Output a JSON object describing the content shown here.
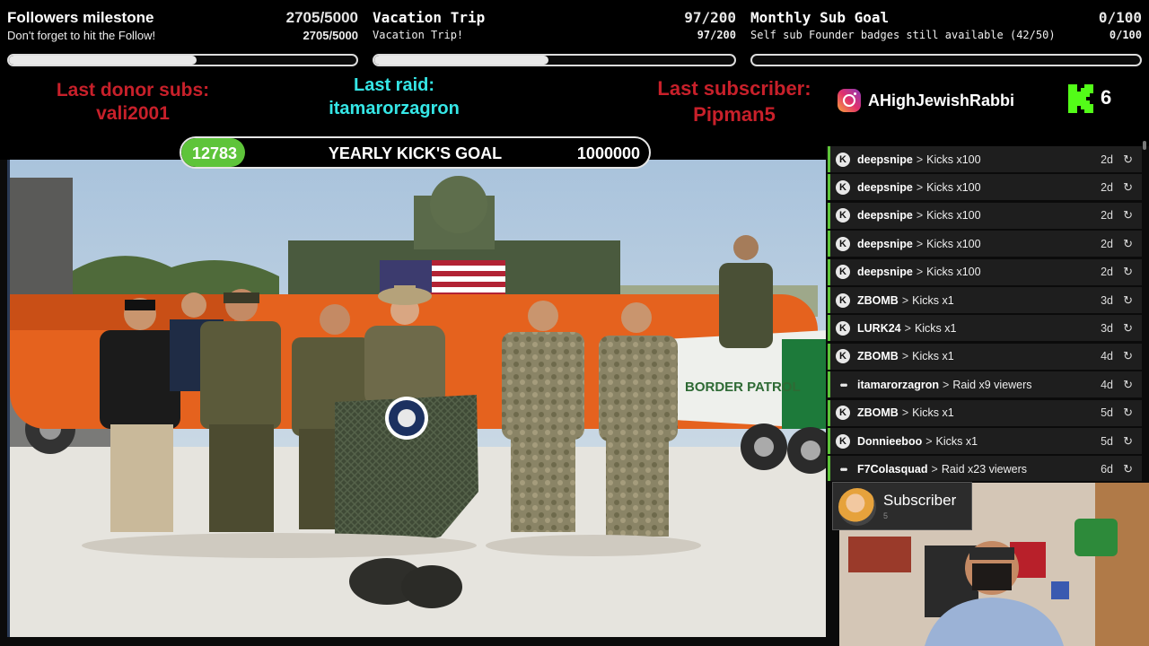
{
  "goals": [
    {
      "title": "Followers milestone",
      "count": "2705/5000",
      "subtitle": "Don't forget to hit the Follow!",
      "subcount": "2705/5000",
      "progress": 0.541
    },
    {
      "title": "Vacation Trip",
      "count": "97/200",
      "subtitle": "Vacation Trip!",
      "subcount": "97/200",
      "progress": 0.485
    },
    {
      "title": "Monthly Sub Goal",
      "count": "0/100",
      "subtitle": "Self sub Founder badges still available (42/50)",
      "subcount": "0/100",
      "progress": 0
    }
  ],
  "info": {
    "donor_label": "Last donor subs:",
    "donor_name": "vali2001",
    "raid_label": "Last raid:",
    "raid_name": "itamarorzagron",
    "subscriber_label": "Last subscriber:",
    "subscriber_name": "Pipman5",
    "instagram_handle": "AHighJewishRabbi",
    "kick_count": "6"
  },
  "yearly_goal": {
    "current": "12783",
    "label": "YEARLY KICK'S GOAL",
    "target": "1000000",
    "progress": 0.012783
  },
  "video": {
    "boat_text": "BORDER PATROL"
  },
  "feed": [
    {
      "type": "kick",
      "user": "deepsnipe",
      "action": "Kicks x100",
      "time": "2d"
    },
    {
      "type": "kick",
      "user": "deepsnipe",
      "action": "Kicks x100",
      "time": "2d"
    },
    {
      "type": "kick",
      "user": "deepsnipe",
      "action": "Kicks x100",
      "time": "2d"
    },
    {
      "type": "kick",
      "user": "deepsnipe",
      "action": "Kicks x100",
      "time": "2d"
    },
    {
      "type": "kick",
      "user": "deepsnipe",
      "action": "Kicks x100",
      "time": "2d"
    },
    {
      "type": "kick",
      "user": "ZBOMB",
      "action": "Kicks x1",
      "time": "3d"
    },
    {
      "type": "kick",
      "user": "LURK24",
      "action": "Kicks x1",
      "time": "3d"
    },
    {
      "type": "kick",
      "user": "ZBOMB",
      "action": "Kicks x1",
      "time": "4d"
    },
    {
      "type": "raid",
      "user": "itamarorzagron",
      "action": "Raid x9 viewers",
      "time": "4d"
    },
    {
      "type": "kick",
      "user": "ZBOMB",
      "action": "Kicks x1",
      "time": "5d"
    },
    {
      "type": "kick",
      "user": "Donnieeboo",
      "action": "Kicks x1",
      "time": "5d"
    },
    {
      "type": "raid",
      "user": "F7Colasquad",
      "action": "Raid x23 viewers",
      "time": "6d"
    }
  ],
  "subscriber_card": {
    "label": "Subscriber",
    "number": "5"
  },
  "colors": {
    "accent_green": "#5ec43a",
    "donor_red": "#c8202a",
    "raid_cyan": "#35e6e6"
  }
}
